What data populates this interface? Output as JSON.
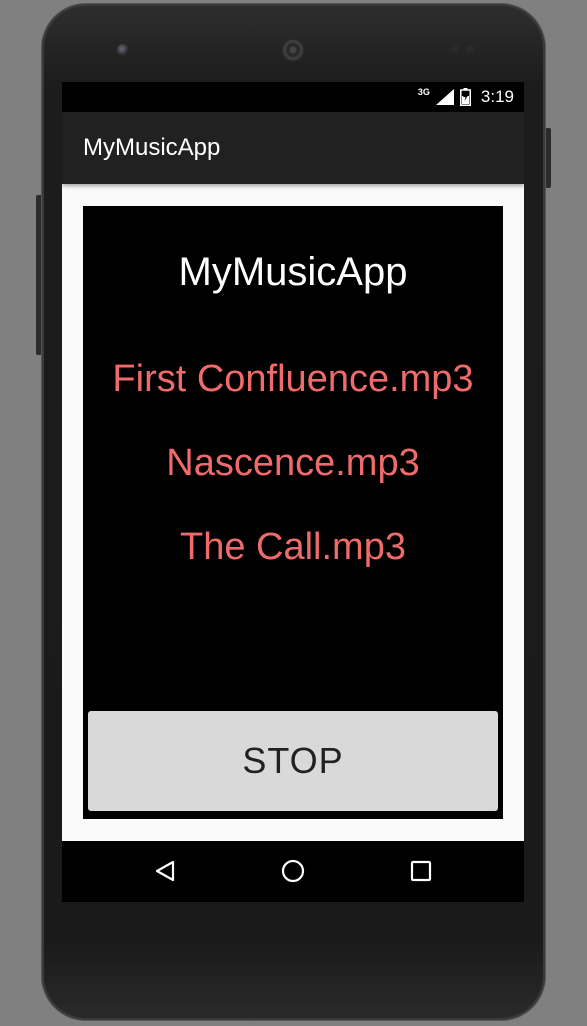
{
  "status_bar": {
    "network_label": "3G",
    "time": "3:19",
    "icons": [
      "signal-icon",
      "battery-icon"
    ]
  },
  "app_bar": {
    "title": "MyMusicApp"
  },
  "main": {
    "heading": "MyMusicApp",
    "songs": [
      {
        "title": "First Confluence.mp3"
      },
      {
        "title": "Nascence.mp3"
      },
      {
        "title": "The Call.mp3"
      }
    ],
    "stop_label": "STOP"
  },
  "nav_bar": {
    "icons": [
      "back-icon",
      "home-icon",
      "recents-icon"
    ]
  },
  "colors": {
    "song_text": "#ef6b6b",
    "content_bg": "#000000",
    "app_bar_bg": "#212121",
    "button_bg": "#d9d9d9"
  }
}
